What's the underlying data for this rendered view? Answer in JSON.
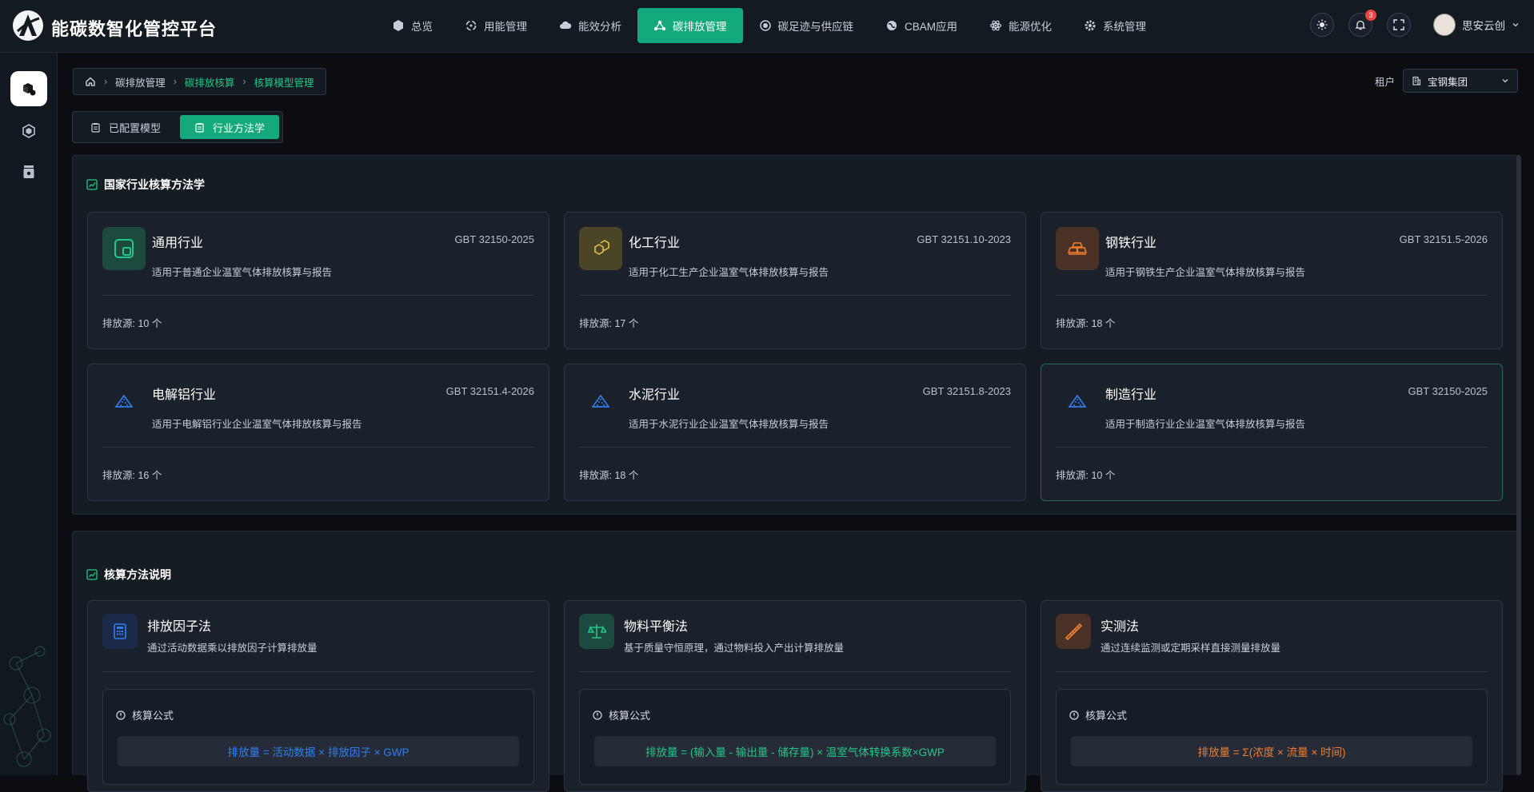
{
  "app": {
    "title": "能碳数智化管控平台"
  },
  "nav": {
    "items": [
      {
        "label": "总览",
        "icon": "cube-icon"
      },
      {
        "label": "用能管理",
        "icon": "recycle-icon"
      },
      {
        "label": "能效分析",
        "icon": "cloud-icon"
      },
      {
        "label": "碳排放管理",
        "icon": "network-icon"
      },
      {
        "label": "碳足迹与供应链",
        "icon": "target-icon"
      },
      {
        "label": "CBAM应用",
        "icon": "globe-icon"
      },
      {
        "label": "能源优化",
        "icon": "atom-icon"
      },
      {
        "label": "系统管理",
        "icon": "gear-icon"
      }
    ],
    "active": "碳排放管理"
  },
  "header": {
    "notification_count": "3",
    "user_name": "思安云创"
  },
  "breadcrumb": {
    "items": [
      "碳排放管理",
      "碳排放核算",
      "核算模型管理"
    ]
  },
  "tenant": {
    "label": "租户",
    "value": "宝钢集团"
  },
  "tabs": [
    {
      "label": "已配置模型"
    },
    {
      "label": "行业方法学"
    }
  ],
  "industries": {
    "title": "国家行业核算方法学",
    "cards": [
      {
        "name": "通用行业",
        "standard": "GBT 32150-2025",
        "desc": "适用于普通企业温室气体排放核算与报告",
        "count": "排放源: 10 个"
      },
      {
        "name": "化工行业",
        "standard": "GBT 32151.10-2023",
        "desc": "适用于化工生产企业温室气体排放核算与报告",
        "count": "排放源: 17 个"
      },
      {
        "name": "钢铁行业",
        "standard": "GBT 32151.5-2026",
        "desc": "适用于钢铁生产企业温室气体排放核算与报告",
        "count": "排放源: 18 个"
      },
      {
        "name": "电解铝行业",
        "standard": "GBT 32151.4-2026",
        "desc": "适用于电解铝行业企业温室气体排放核算与报告",
        "count": "排放源: 16 个"
      },
      {
        "name": "水泥行业",
        "standard": "GBT 32151.8-2023",
        "desc": "适用于水泥行业企业温室气体排放核算与报告",
        "count": "排放源: 18 个"
      },
      {
        "name": "制造行业",
        "standard": "GBT 32150-2025",
        "desc": "适用于制造行业企业温室气体排放核算与报告",
        "count": "排放源: 10 个"
      }
    ]
  },
  "methods": {
    "title": "核算方法说明",
    "formula_label": "核算公式",
    "cards": [
      {
        "name": "排放因子法",
        "desc": "通过活动数据乘以排放因子计算排放量",
        "formula": "排放量 = 活动数据 × 排放因子 × GWP",
        "color": "#2f7ff0"
      },
      {
        "name": "物料平衡法",
        "desc": "基于质量守恒原理，通过物料投入产出计算排放量",
        "formula": "排放量 = (输入量 - 输出量 - 储存量) × 温室气体转换系数×GWP",
        "color": "#22c58b"
      },
      {
        "name": "实测法",
        "desc": "通过连续监测或定期采样直接测量排放量",
        "formula": "排放量 = Σ(浓度 × 流量 × 时间)",
        "color": "#f07d2f"
      }
    ]
  },
  "colors": {
    "accent": "#14a97a",
    "accent_text": "#22c58b"
  }
}
